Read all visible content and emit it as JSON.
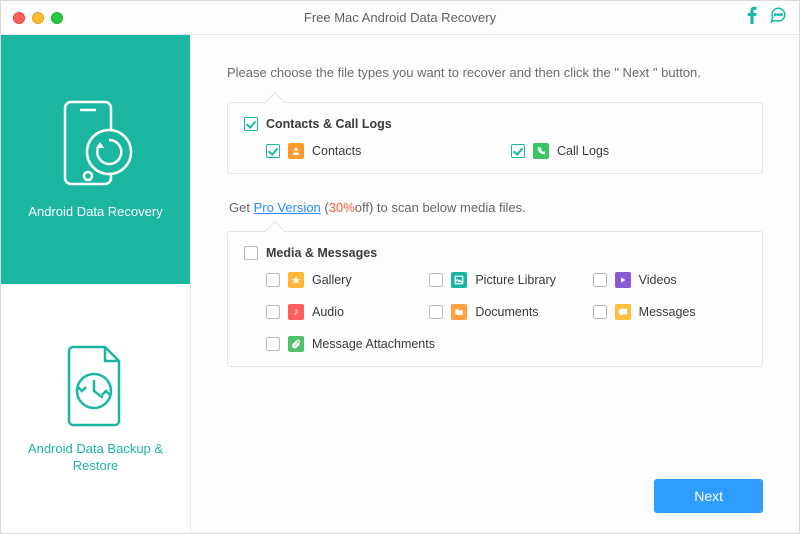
{
  "accent": "#1bb6a2",
  "titlebar": {
    "title": "Free Mac Android Data Recovery"
  },
  "sidebar": {
    "items": [
      {
        "label": "Android Data Recovery"
      },
      {
        "label": "Android Data Backup & Restore"
      }
    ]
  },
  "main": {
    "instruction": "Please choose the file types you want to recover and then click the \" Next \" button.",
    "group1": {
      "title": "Contacts & Call Logs",
      "items": [
        {
          "label": "Contacts"
        },
        {
          "label": "Call Logs"
        }
      ]
    },
    "pro": {
      "prefix": "Get ",
      "link": "Pro Version",
      "mid": " (",
      "pct": "30%",
      "suffix": "off) to scan below media files."
    },
    "group2": {
      "title": "Media & Messages",
      "items": [
        {
          "label": "Gallery"
        },
        {
          "label": "Picture Library"
        },
        {
          "label": "Videos"
        },
        {
          "label": "Audio"
        },
        {
          "label": "Documents"
        },
        {
          "label": "Messages"
        },
        {
          "label": "Message Attachments"
        }
      ]
    },
    "next": "Next"
  }
}
